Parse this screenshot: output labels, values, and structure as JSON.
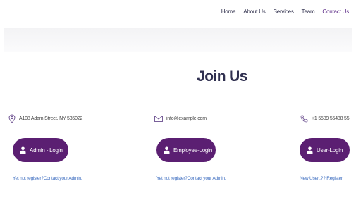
{
  "nav": {
    "items": [
      {
        "label": "Home"
      },
      {
        "label": "About Us"
      },
      {
        "label": "Services"
      },
      {
        "label": "Team"
      },
      {
        "label": "Contact Us"
      }
    ]
  },
  "main": {
    "title": "Join Us"
  },
  "contact": {
    "address": "A108 Adam Street, NY 535022",
    "email": "info@example.com",
    "phone": "+1 5589 55488 55"
  },
  "logins": {
    "admin": {
      "label": "Admin - Login",
      "note": "Yet not register?Contact your Admin."
    },
    "employee": {
      "label": "Employee-Login",
      "note": "Yet not register?Contact your Admin."
    },
    "user": {
      "label": "User-Login",
      "note": "New User..?? Register"
    }
  },
  "colors": {
    "accent": "#5b1f72",
    "link": "#3a6bbf",
    "active_nav": "#5b2a86"
  },
  "icons": {
    "address": "map-pin-icon",
    "email": "envelope-icon",
    "phone": "phone-icon",
    "login": "user-icon"
  }
}
